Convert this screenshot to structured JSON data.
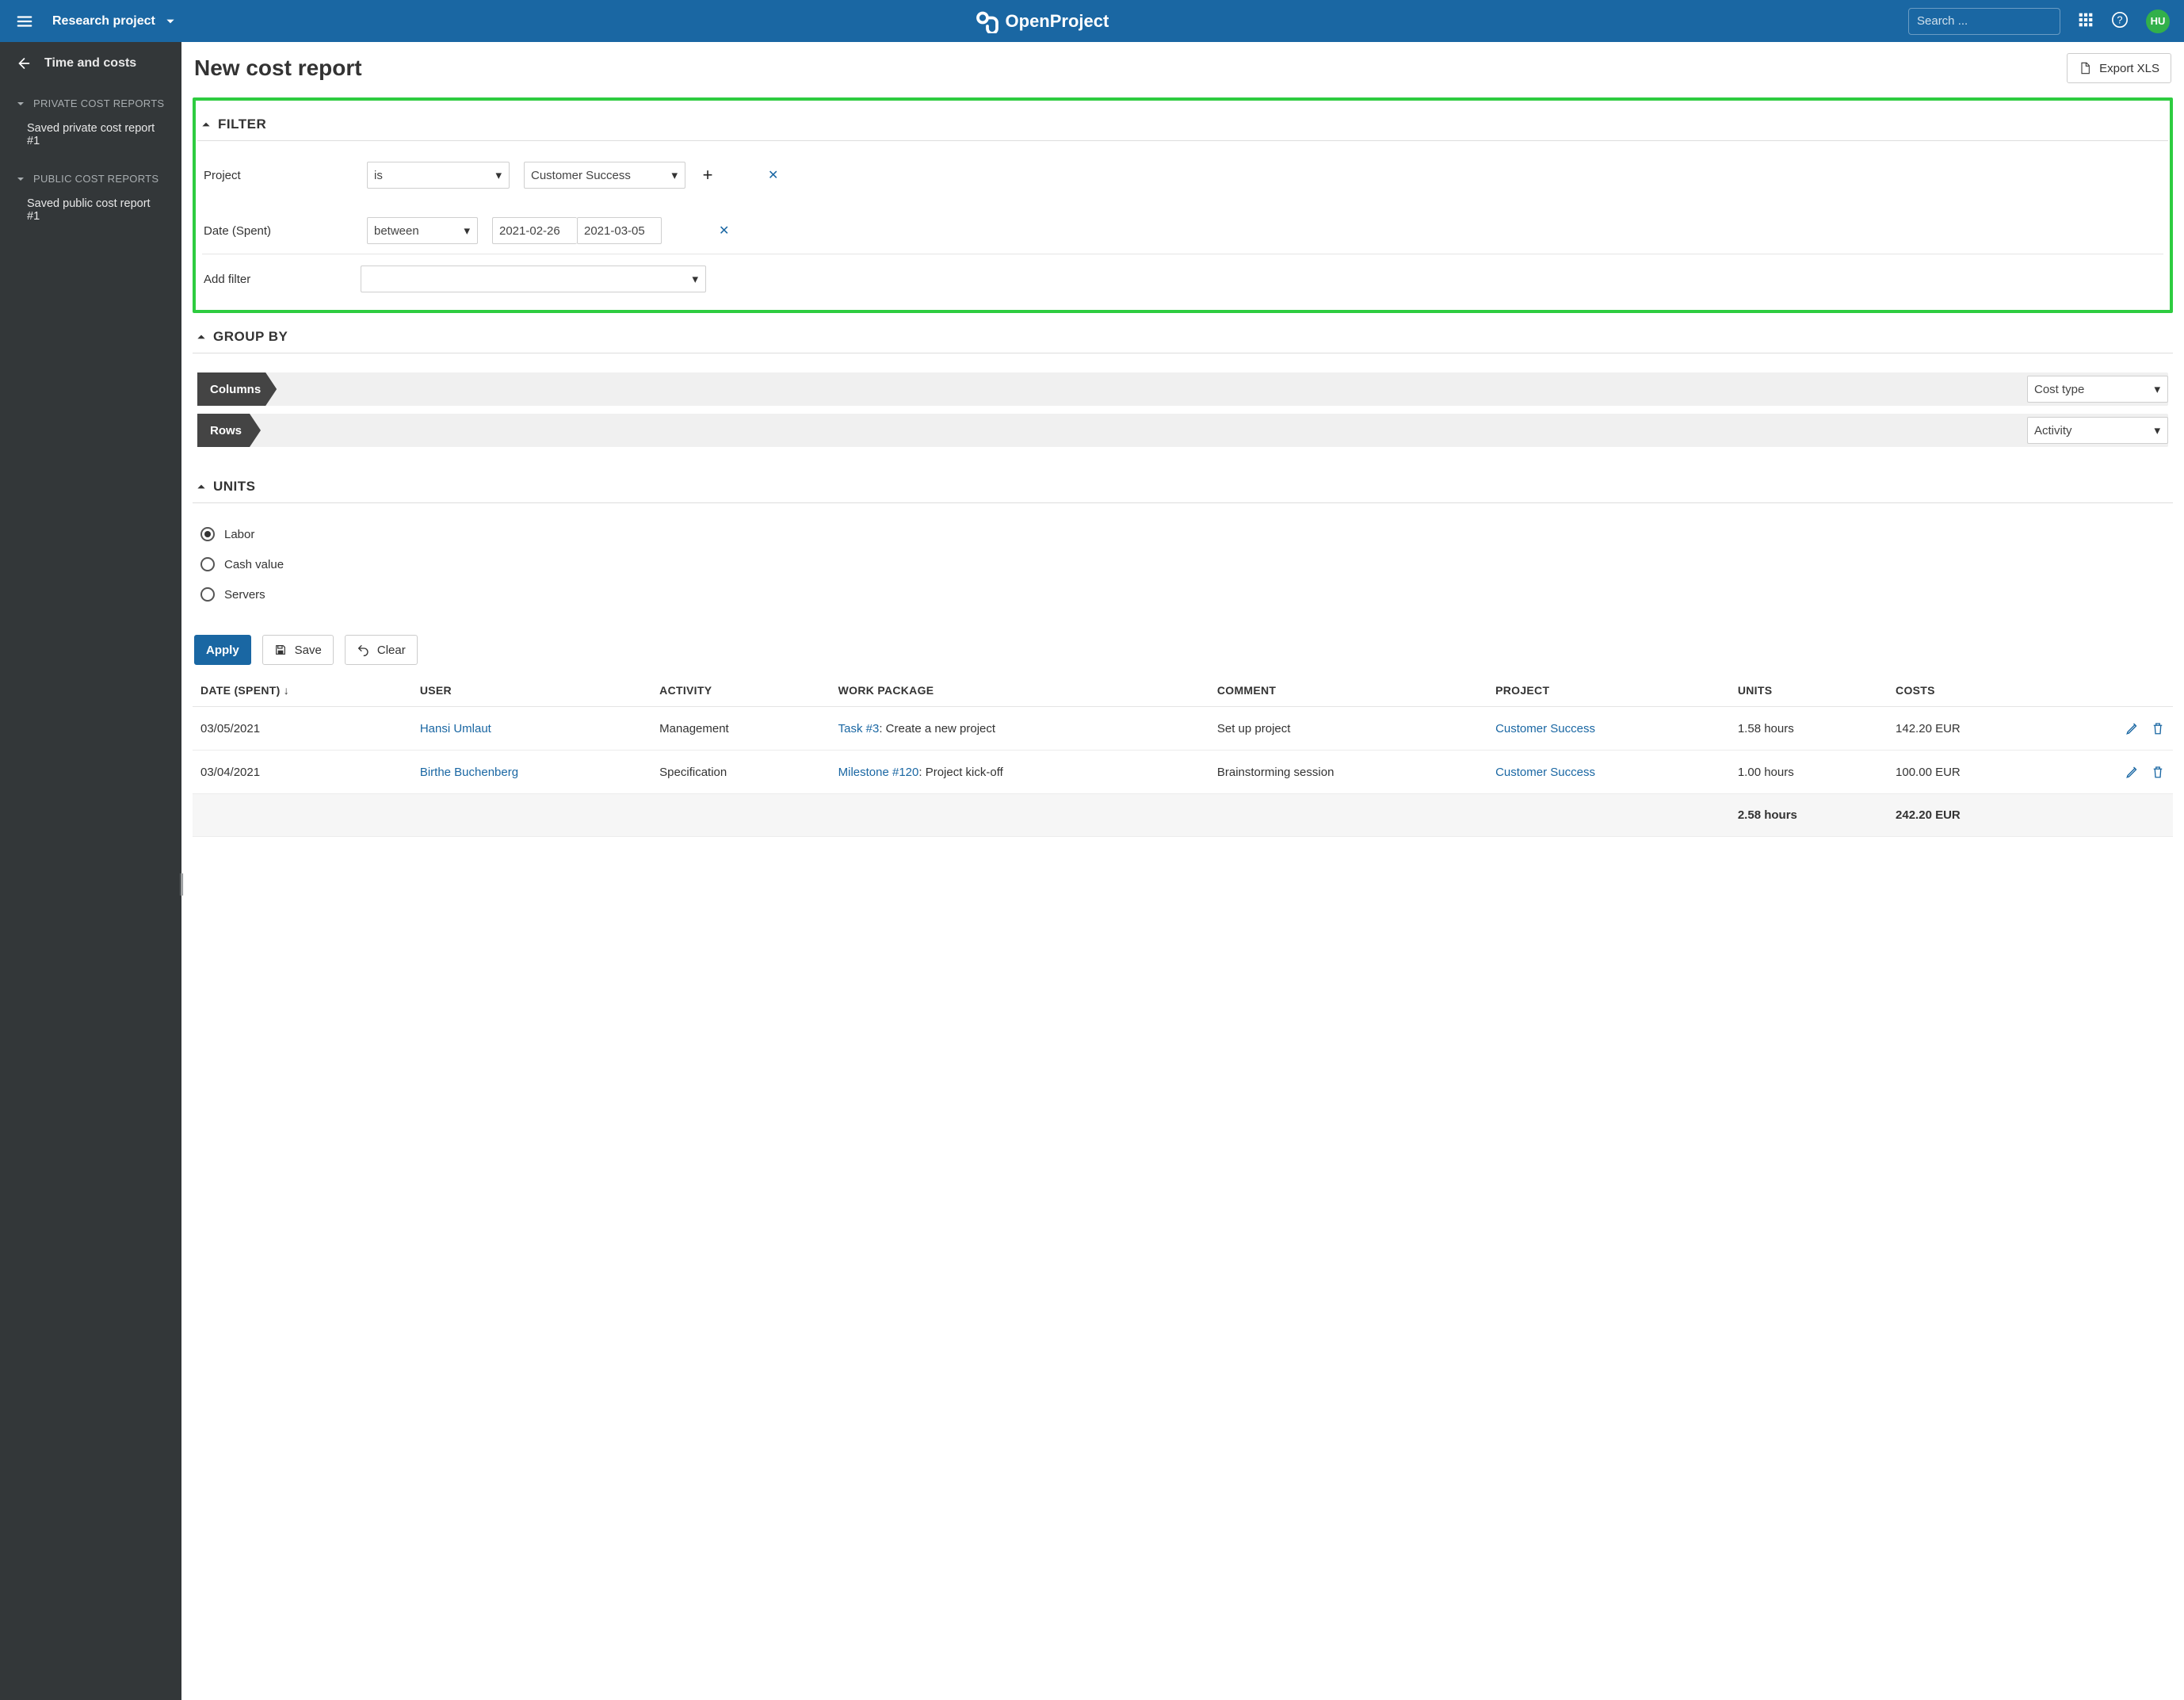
{
  "header": {
    "project_name": "Research project",
    "search_placeholder": "Search ...",
    "avatar_initials": "HU"
  },
  "sidebar": {
    "back_label": "Time and costs",
    "groups": [
      {
        "title": "PRIVATE COST REPORTS",
        "items": [
          "Saved private cost report #1"
        ]
      },
      {
        "title": "PUBLIC COST REPORTS",
        "items": [
          "Saved public cost report #1"
        ]
      }
    ]
  },
  "page": {
    "title": "New cost report",
    "export_label": "Export XLS"
  },
  "sections": {
    "filter": "FILTER",
    "groupby": "GROUP BY",
    "units": "UNITS"
  },
  "filters": {
    "project": {
      "label": "Project",
      "operator": "is",
      "value": "Customer Success"
    },
    "date": {
      "label": "Date (Spent)",
      "operator": "between",
      "from": "2021-02-26",
      "to": "2021-03-05"
    },
    "add_label": "Add filter"
  },
  "groupby": {
    "columns_label": "Columns",
    "rows_label": "Rows",
    "columns_add": "Cost type",
    "rows_add": "Activity"
  },
  "units": {
    "options": [
      "Labor",
      "Cash value",
      "Servers"
    ],
    "selected": "Labor"
  },
  "actions": {
    "apply": "Apply",
    "save": "Save",
    "clear": "Clear"
  },
  "table": {
    "headers": {
      "date": "DATE (SPENT)",
      "user": "USER",
      "activity": "ACTIVITY",
      "wp": "WORK PACKAGE",
      "comment": "COMMENT",
      "project": "PROJECT",
      "units": "UNITS",
      "costs": "COSTS"
    },
    "rows": [
      {
        "date": "03/05/2021",
        "user": "Hansi Umlaut",
        "activity": "Management",
        "wp_id": "Task #3",
        "wp_rest": ": Create a new project",
        "comment": "Set up project",
        "project": "Customer Success",
        "units": "1.58 hours",
        "costs": "142.20 EUR"
      },
      {
        "date": "03/04/2021",
        "user": "Birthe Buchenberg",
        "activity": "Specification",
        "wp_id": "Milestone #120",
        "wp_rest": ": Project kick-off",
        "comment": "Brainstorming session",
        "project": "Customer Success",
        "units": "1.00 hours",
        "costs": "100.00 EUR"
      }
    ],
    "totals": {
      "units": "2.58 hours",
      "costs": "242.20 EUR"
    }
  }
}
